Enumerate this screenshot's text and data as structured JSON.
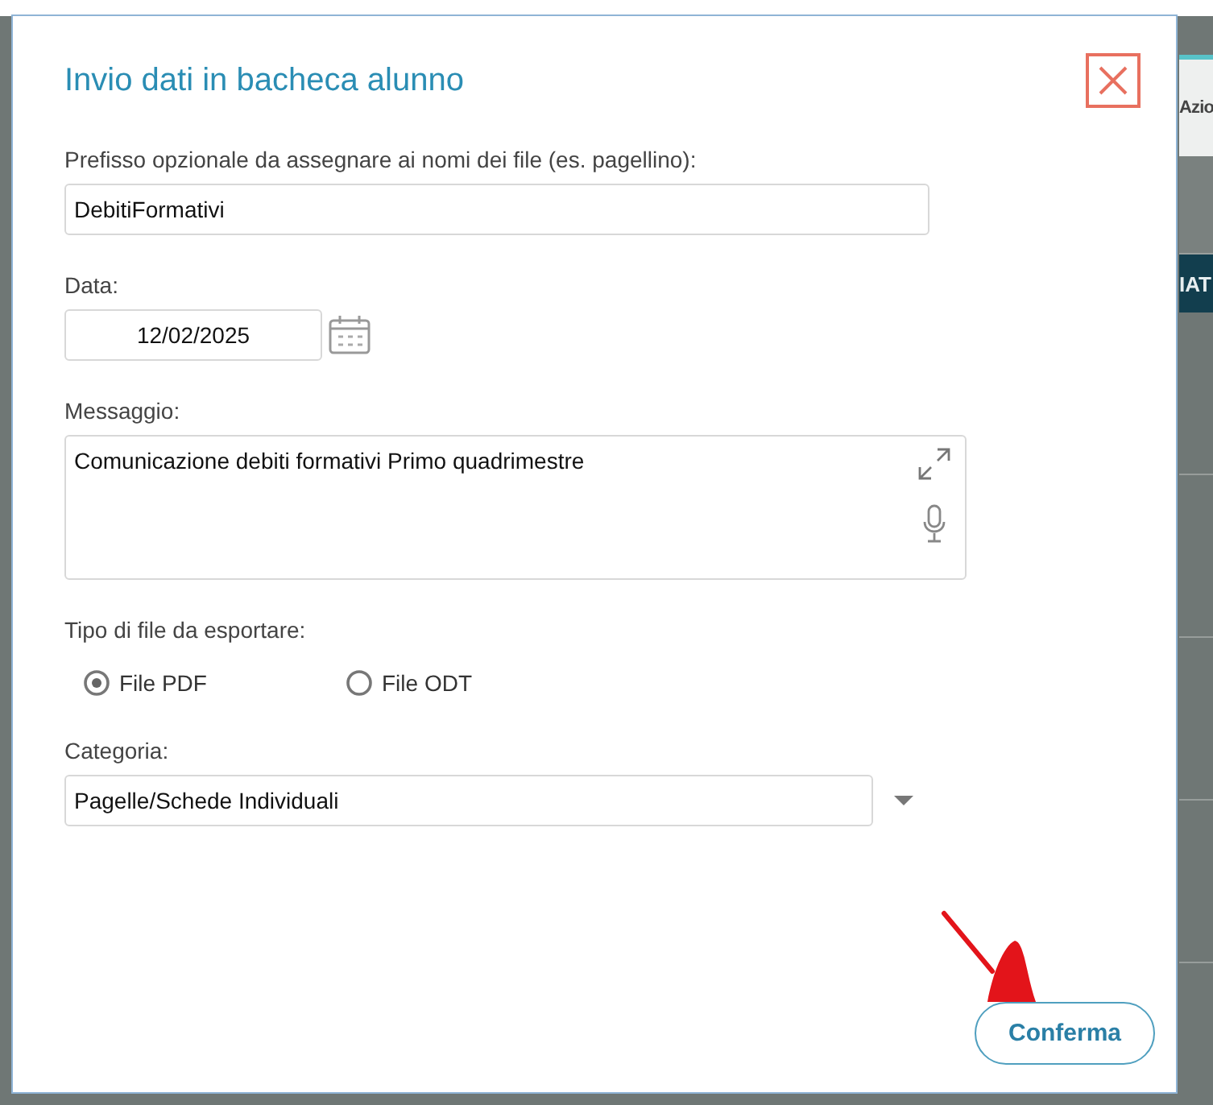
{
  "background": {
    "column_header": "Azio",
    "header_bar": "IAT"
  },
  "dialog": {
    "title": "Invio dati in bacheca alunno",
    "fields": [
      {
        "kind": "text",
        "label": "Prefisso opzionale da assegnare ai nomi dei file (es. pagellino):",
        "value": "DebitiFormativi"
      },
      {
        "kind": "date",
        "label": "Data:",
        "value": "12/02/2025"
      },
      {
        "kind": "textarea",
        "label": "Messaggio:",
        "value": "Comunicazione debiti formativi Primo quadrimestre"
      },
      {
        "kind": "radio",
        "label": "Tipo di file da esportare:",
        "options": [
          {
            "label": "File PDF",
            "selected": true
          },
          {
            "label": "File ODT",
            "selected": false
          }
        ]
      },
      {
        "kind": "select",
        "label": "Categoria:",
        "value": "Pagelle/Schede Individuali"
      }
    ],
    "confirm_button": "Conferma"
  }
}
